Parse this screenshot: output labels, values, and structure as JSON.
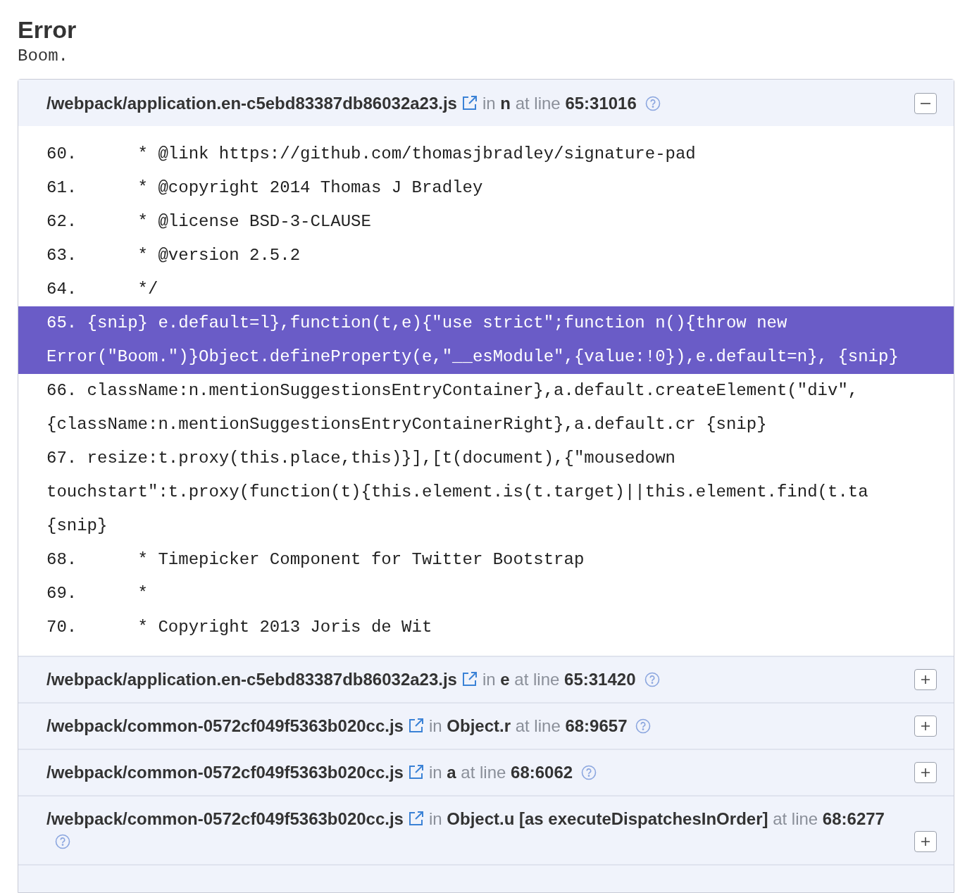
{
  "title": "Error",
  "message": "Boom.",
  "frames": [
    {
      "file": "/webpack/application.en-c5ebd83387db86032a23.js",
      "in_label": "in",
      "function": "n",
      "at_label": "at line",
      "location": "65:31016",
      "expanded": true,
      "lines": [
        {
          "number": "60.",
          "code": "     * @link https://github.com/thomasjbradley/signature-pad",
          "highlighted": false
        },
        {
          "number": "61.",
          "code": "     * @copyright 2014 Thomas J Bradley",
          "highlighted": false
        },
        {
          "number": "62.",
          "code": "     * @license BSD-3-CLAUSE",
          "highlighted": false
        },
        {
          "number": "63.",
          "code": "     * @version 2.5.2",
          "highlighted": false
        },
        {
          "number": "64.",
          "code": "     */",
          "highlighted": false
        },
        {
          "number": "65.",
          "code": "{snip} e.default=l},function(t,e){\"use strict\";function n(){throw new Error(\"Boom.\")}Object.defineProperty(e,\"__esModule\",{value:!0}),e.default=n}, {snip}",
          "highlighted": true
        },
        {
          "number": "66.",
          "code": "className:n.mentionSuggestionsEntryContainer},a.default.createElement(\"div\", {className:n.mentionSuggestionsEntryContainerRight},a.default.cr {snip}",
          "highlighted": false
        },
        {
          "number": "67.",
          "code": "resize:t.proxy(this.place,this)}],[t(document),{\"mousedown touchstart\":t.proxy(function(t){this.element.is(t.target)||this.element.find(t.ta {snip}",
          "highlighted": false
        },
        {
          "number": "68.",
          "code": "     * Timepicker Component for Twitter Bootstrap",
          "highlighted": false
        },
        {
          "number": "69.",
          "code": "     *",
          "highlighted": false
        },
        {
          "number": "70.",
          "code": "     * Copyright 2013 Joris de Wit",
          "highlighted": false
        }
      ]
    },
    {
      "file": "/webpack/application.en-c5ebd83387db86032a23.js",
      "in_label": "in",
      "function": "e",
      "at_label": "at line",
      "location": "65:31420",
      "expanded": false
    },
    {
      "file": "/webpack/common-0572cf049f5363b020cc.js",
      "in_label": "in",
      "function": "Object.r",
      "at_label": "at line",
      "location": "68:9657",
      "expanded": false
    },
    {
      "file": "/webpack/common-0572cf049f5363b020cc.js",
      "in_label": "in",
      "function": "a",
      "at_label": "at line",
      "location": "68:6062",
      "expanded": false
    },
    {
      "file": "/webpack/common-0572cf049f5363b020cc.js",
      "in_label": "in",
      "function": "Object.u [as executeDispatchesInOrder]",
      "at_label": "at line",
      "location": "68:6277",
      "expanded": false
    }
  ]
}
